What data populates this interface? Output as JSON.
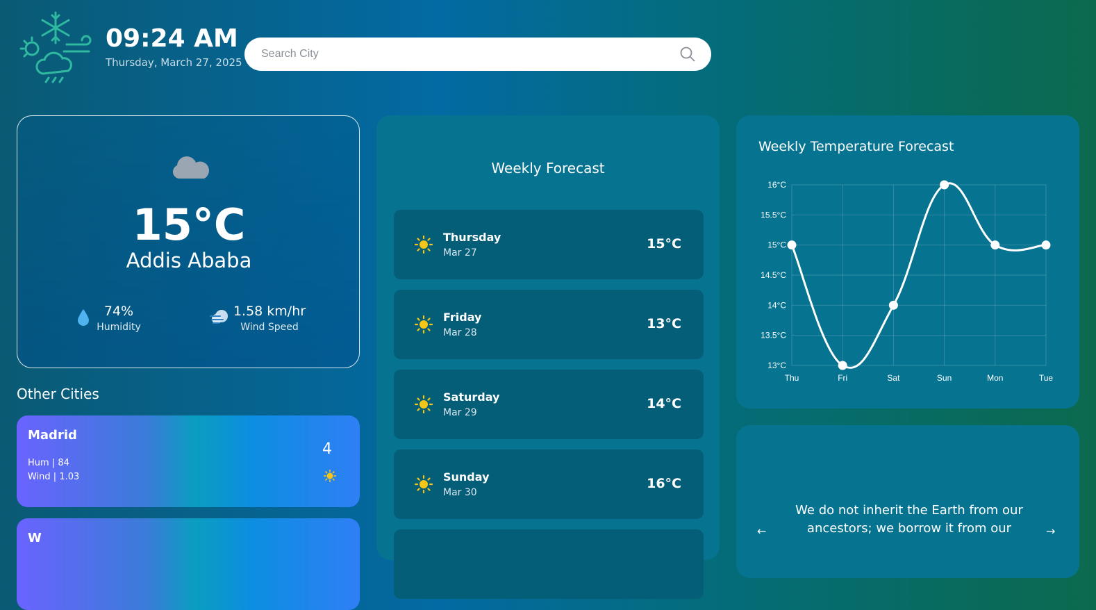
{
  "header": {
    "time": "09:24 AM",
    "date": "Thursday, March 27, 2025",
    "search_placeholder": "Search City"
  },
  "current": {
    "condition_icon": "cloud-icon",
    "temperature": "15°C",
    "city": "Addis Ababa",
    "humidity_value": "74%",
    "humidity_label": "Humidity",
    "wind_value": "1.58 km/hr",
    "wind_label": "Wind Speed"
  },
  "other_cities": {
    "title": "Other Cities",
    "items": [
      {
        "name": "Madrid",
        "hum": "Hum | 84",
        "wind": "Wind | 1.03",
        "value": "4",
        "icon": "sun-icon"
      },
      {
        "name": "W",
        "hum": "",
        "wind": "",
        "value": "",
        "icon": ""
      }
    ]
  },
  "weekly_forecast": {
    "title": "Weekly Forecast",
    "days": [
      {
        "day": "Thursday",
        "date": "Mar 27",
        "temp": "15°C",
        "icon": "sun-icon"
      },
      {
        "day": "Friday",
        "date": "Mar 28",
        "temp": "13°C",
        "icon": "sun-icon"
      },
      {
        "day": "Saturday",
        "date": "Mar 29",
        "temp": "14°C",
        "icon": "sun-icon"
      },
      {
        "day": "Sunday",
        "date": "Mar 30",
        "temp": "16°C",
        "icon": "sun-icon"
      }
    ]
  },
  "chart_data": {
    "type": "line",
    "title": "Weekly Temperature Forecast",
    "categories": [
      "Thu",
      "Fri",
      "Sat",
      "Sun",
      "Mon",
      "Tue"
    ],
    "values": [
      15,
      13,
      14,
      16,
      15,
      15
    ],
    "yticks": [
      "13°C",
      "13.5°C",
      "14°C",
      "14.5°C",
      "15°C",
      "15.5°C",
      "16°C"
    ],
    "ylim": [
      13,
      16
    ],
    "grid": true,
    "line_color": "#ffffff"
  },
  "quote": {
    "text": "We do not inherit the Earth from our ancestors; we borrow it from our",
    "prev": "←",
    "next": "→"
  },
  "colors": {
    "accent_sun": "#f5c518",
    "panel": "#067391",
    "row": "#055e78"
  }
}
